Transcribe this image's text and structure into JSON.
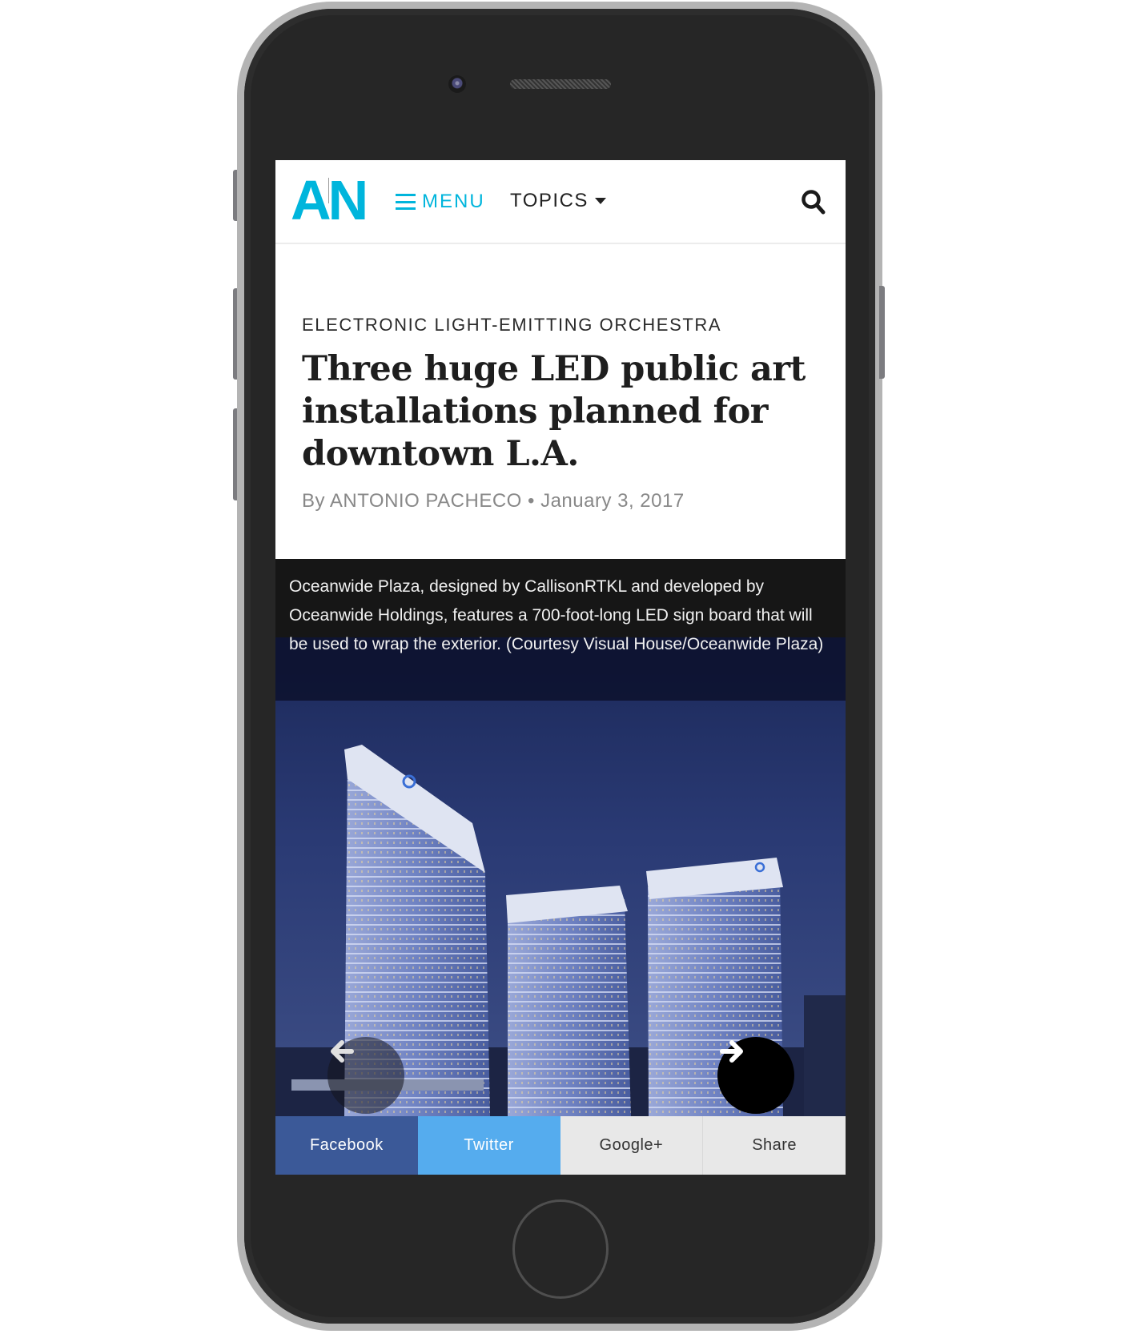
{
  "site": {
    "logo_left": "A",
    "logo_right": "N",
    "menu_label": "MENU",
    "topics_label": "TOPICS",
    "brand_color": "#00b5dc"
  },
  "article": {
    "kicker": "ELECTRONIC LIGHT-EMITTING ORCHESTRA",
    "headline": "Three huge LED public art installations planned for downtown L.A.",
    "byline": "By ANTONIO PACHECO • January 3, 2017"
  },
  "gallery": {
    "caption": "Oceanwide Plaza, designed by CallisonRTKL and developed by Oceanwide Holdings, features a 700-foot-long LED sign board that will be used to wrap the exterior. (Courtesy Visual House/Oceanwide Plaza)",
    "image_alt": "Rendering of three Oceanwide Plaza towers at dusk"
  },
  "share": {
    "buttons": [
      {
        "label": "Facebook",
        "color": "#3b5998"
      },
      {
        "label": "Twitter",
        "color": "#55acee"
      },
      {
        "label": "Google+",
        "color": "#e8e8e8"
      },
      {
        "label": "Share",
        "color": "#e8e8e8"
      }
    ]
  }
}
